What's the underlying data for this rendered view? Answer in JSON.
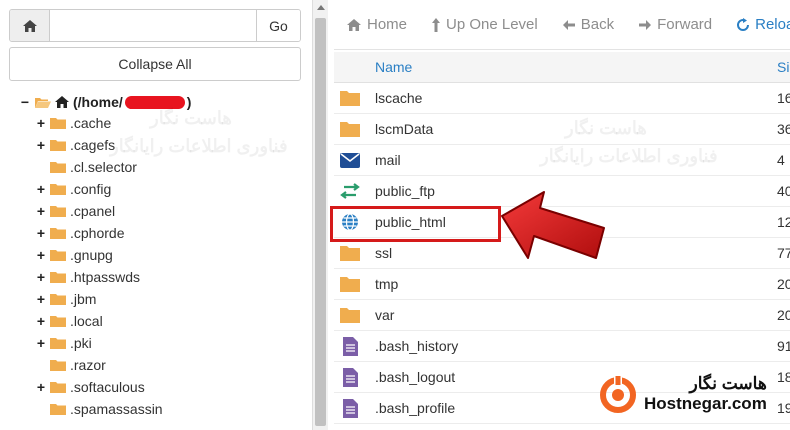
{
  "left": {
    "path_value": "",
    "go_label": "Go",
    "collapse_label": "Collapse All",
    "root": {
      "toggle": "−",
      "label_prefix": "(/home/",
      "label_suffix": ")"
    },
    "tree_items": [
      {
        "toggle": "+",
        "label": ".cache"
      },
      {
        "toggle": "+",
        "label": ".cagefs"
      },
      {
        "toggle": "",
        "label": ".cl.selector"
      },
      {
        "toggle": "+",
        "label": ".config"
      },
      {
        "toggle": "+",
        "label": ".cpanel"
      },
      {
        "toggle": "+",
        "label": ".cphorde"
      },
      {
        "toggle": "+",
        "label": ".gnupg"
      },
      {
        "toggle": "+",
        "label": ".htpasswds"
      },
      {
        "toggle": "+",
        "label": ".jbm"
      },
      {
        "toggle": "+",
        "label": ".local"
      },
      {
        "toggle": "+",
        "label": ".pki"
      },
      {
        "toggle": "",
        "label": ".razor"
      },
      {
        "toggle": "+",
        "label": ".softaculous"
      },
      {
        "toggle": "",
        "label": ".spamassassin"
      }
    ]
  },
  "toolbar": {
    "home": "Home",
    "up": "Up One Level",
    "back": "Back",
    "forward": "Forward",
    "reload": "Reload"
  },
  "grid": {
    "name_header": "Name",
    "size_header": "Si",
    "rows": [
      {
        "icon": "folder-icon",
        "name": "lscache",
        "size": "16"
      },
      {
        "icon": "folder-icon",
        "name": "lscmData",
        "size": "36"
      },
      {
        "icon": "mail-icon",
        "name": "mail",
        "size": "4"
      },
      {
        "icon": "ftp-icon",
        "name": "public_ftp",
        "size": "40"
      },
      {
        "icon": "globe-icon",
        "name": "public_html",
        "size": "12"
      },
      {
        "icon": "folder-icon",
        "name": "ssl",
        "size": "77"
      },
      {
        "icon": "folder-icon",
        "name": "tmp",
        "size": "20"
      },
      {
        "icon": "folder-icon",
        "name": "var",
        "size": "20"
      },
      {
        "icon": "file-icon",
        "name": ".bash_history",
        "size": "91"
      },
      {
        "icon": "file-icon",
        "name": ".bash_logout",
        "size": "18"
      },
      {
        "icon": "file-icon",
        "name": ".bash_profile",
        "size": "19"
      }
    ]
  },
  "brand": {
    "fa": "هاست نگار",
    "en": "Hostnegar.com"
  },
  "watermark": {
    "line1": "هاست نگار",
    "line2": "فناوری اطلاعات رایانگار"
  },
  "colors": {
    "folder": "#f0ad4e",
    "accent_blue": "#2a7fc4",
    "highlight_red": "#d51a1a",
    "file_purple": "#7b5ea7",
    "ftp_green": "#2a9d6c",
    "mail_navy": "#1f4e96",
    "brand_orange": "#f26522"
  }
}
